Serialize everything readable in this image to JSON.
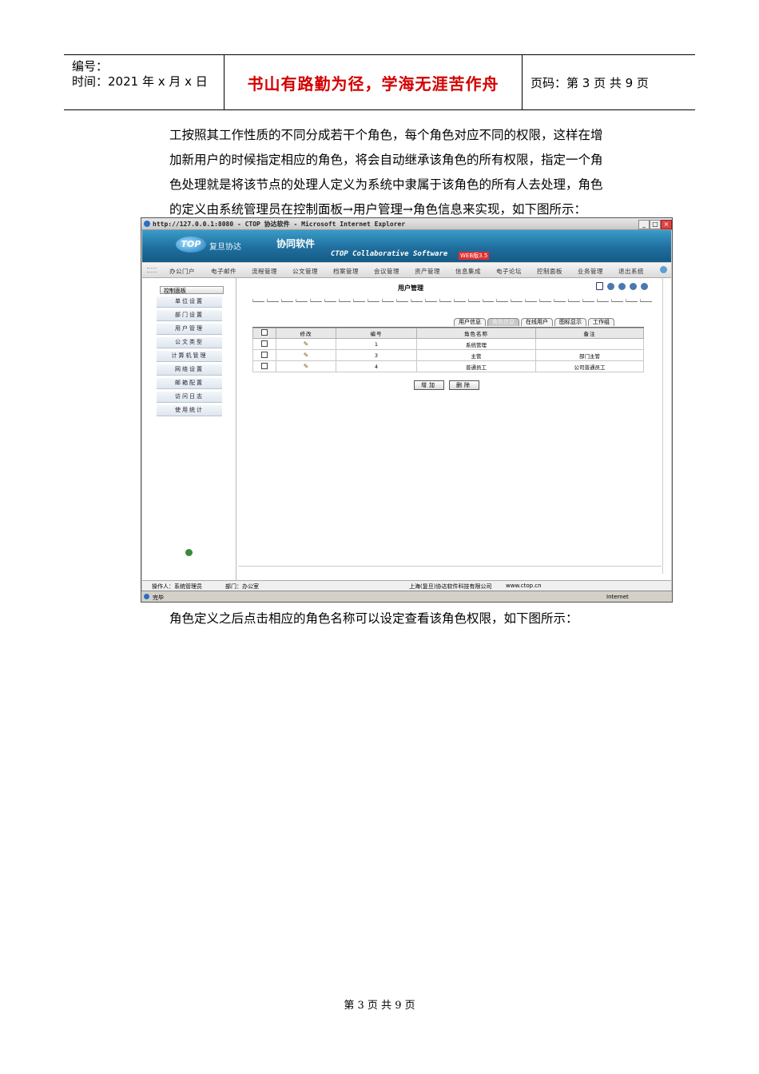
{
  "header": {
    "number_label": "编号：",
    "time_label": "时间：2021 年 x 月 x 日",
    "motto": "书山有路勤为径，学海无涯苦作舟",
    "page_code": "页码：第 3 页  共 9 页"
  },
  "paragraph1": [
    "工按照其工作性质的不同分成若干个角色，每个角色对应不同的权限，这样在增",
    "加新用户的时候指定相应的角色，将会自动继承该角色的所有权限，指定一个角",
    "色处理就是将该节点的处理人定义为系统中隶属于该角色的所有人去处理，角色",
    "的定义由系统管理员在控制面板→用户管理→角色信息来实现，如下图所示："
  ],
  "screenshot": {
    "window_title": "http://127.0.0.1:8080 - CTOP 协达软件 - Microsoft Internet Explorer",
    "logo": "TOP",
    "brand": "复旦协达",
    "product": "协同软件",
    "subtitle": "CTOP Collaborative Software",
    "version_badge": "WEB版3.5",
    "nav": [
      "办公门户",
      "电子邮件",
      "流程管理",
      "公文管理",
      "档案管理",
      "会议管理",
      "资产管理",
      "信息集成",
      "电子论坛",
      "控制面板",
      "业务管理",
      "退出系统"
    ],
    "sidebar_title": "控制面板",
    "sidebar_items": [
      "单位设置",
      "部门设置",
      "用户管理",
      "公文类型",
      "计算机管理",
      "网络设置",
      "邮箱配置",
      "访问日志",
      "使用统计"
    ],
    "main_title": "用户管理",
    "tabs": [
      "用户信息",
      "角色信息",
      "在线用户",
      "图标显示",
      "工作组"
    ],
    "active_tab": "角色信息",
    "table_headers": [
      "修改",
      "编号",
      "角色名称",
      "备注"
    ],
    "rows": [
      {
        "id": "1",
        "name": "系统管理",
        "note": ""
      },
      {
        "id": "3",
        "name": "主管",
        "note": "部门主管"
      },
      {
        "id": "4",
        "name": "普通员工",
        "note": "公司普通员工"
      }
    ],
    "buttons": {
      "add": "增加",
      "delete": "删除"
    },
    "status_operator": "操作人：系统管理员",
    "status_dept": "部门：办公室",
    "status_company": "上海(复旦)协达软件科技有限公司",
    "status_site": "www.ctop.cn",
    "ie_status": "完毕",
    "ie_zone": "Internet",
    "colors": {
      "banner": "#1f6f9e",
      "motto": "#d40000"
    }
  },
  "paragraph2": "角色定义之后点击相应的角色名称可以设定查看该角色权限，如下图所示：",
  "footer": "第 3 页 共 9 页"
}
